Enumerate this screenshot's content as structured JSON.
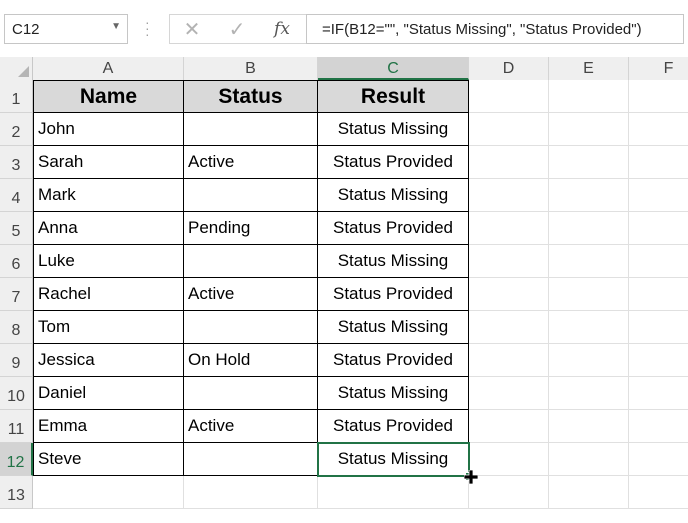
{
  "name_box": {
    "value": "C12"
  },
  "formula_bar": {
    "cancel_icon": "close-icon",
    "enter_icon": "check-icon",
    "function_label": "fx",
    "formula": "=IF(B12=\"\", \"Status Missing\", \"Status Provided\")"
  },
  "columns": [
    "A",
    "B",
    "C",
    "D",
    "E",
    "F"
  ],
  "selected_column": "C",
  "rows": [
    "1",
    "2",
    "3",
    "4",
    "5",
    "6",
    "7",
    "8",
    "9",
    "10",
    "11",
    "12",
    "13"
  ],
  "selected_row": "12",
  "table": {
    "headers": {
      "name": "Name",
      "status": "Status",
      "result": "Result"
    },
    "records": [
      {
        "name": "John",
        "status": "",
        "result": "Status Missing"
      },
      {
        "name": "Sarah",
        "status": "Active",
        "result": "Status Provided"
      },
      {
        "name": "Mark",
        "status": "",
        "result": "Status Missing"
      },
      {
        "name": "Anna",
        "status": "Pending",
        "result": "Status Provided"
      },
      {
        "name": "Luke",
        "status": "",
        "result": "Status Missing"
      },
      {
        "name": "Rachel",
        "status": "Active",
        "result": "Status Provided"
      },
      {
        "name": "Tom",
        "status": "",
        "result": "Status Missing"
      },
      {
        "name": "Jessica",
        "status": "On Hold",
        "result": "Status Provided"
      },
      {
        "name": "Daniel",
        "status": "",
        "result": "Status Missing"
      },
      {
        "name": "Emma",
        "status": "Active",
        "result": "Status Provided"
      },
      {
        "name": "Steve",
        "status": "",
        "result": "Status Missing"
      }
    ]
  },
  "colors": {
    "accent": "#217346",
    "header_fill": "#d9d9d9"
  }
}
